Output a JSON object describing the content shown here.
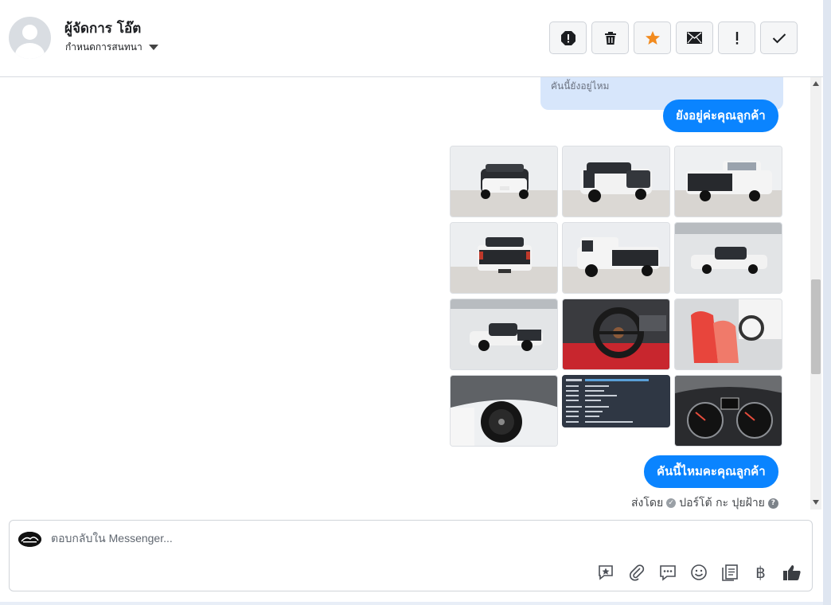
{
  "header": {
    "name": "ผู้จัดการ โอ๊ต",
    "subtitle": "กำหนดการสนทนา",
    "tools": [
      {
        "name": "report-icon"
      },
      {
        "name": "trash-icon"
      },
      {
        "name": "star-icon",
        "color": "#f28b1f"
      },
      {
        "name": "mail-icon"
      },
      {
        "name": "important-icon"
      },
      {
        "name": "check-icon"
      }
    ]
  },
  "messages": {
    "quoted_reply": "คันนี้ยังอยู่ไหม",
    "bubble_1": "ยังอยู่ค่ะคุณลูกค้า",
    "bubble_2": "คันนี้ไหมคะคุณลูกค้า",
    "sent_by_label": "ส่งโดย",
    "sent_by_name": "ปอร์โต้ กะ ปุยฝ้าย",
    "bubble_color": "#0a84ff"
  },
  "images": [
    {
      "name": "car-front-photo"
    },
    {
      "name": "car-front-angle-photo"
    },
    {
      "name": "car-rear-angle-photo"
    },
    {
      "name": "car-rear-photo"
    },
    {
      "name": "car-rear-side-photo"
    },
    {
      "name": "car-side-photo"
    },
    {
      "name": "car-side-left-photo"
    },
    {
      "name": "car-steering-photo"
    },
    {
      "name": "car-seats-photo"
    },
    {
      "name": "car-wheel-photo"
    },
    {
      "name": "car-info-card-photo"
    },
    {
      "name": "car-gauges-photo"
    }
  ],
  "composer": {
    "placeholder": "ตอบกลับใน Messenger...",
    "tools": [
      "saved-reply-icon",
      "attach-icon",
      "comment-icon",
      "emoji-icon",
      "notes-icon",
      "baht-icon",
      "like-icon"
    ],
    "baht_glyph": "฿"
  }
}
